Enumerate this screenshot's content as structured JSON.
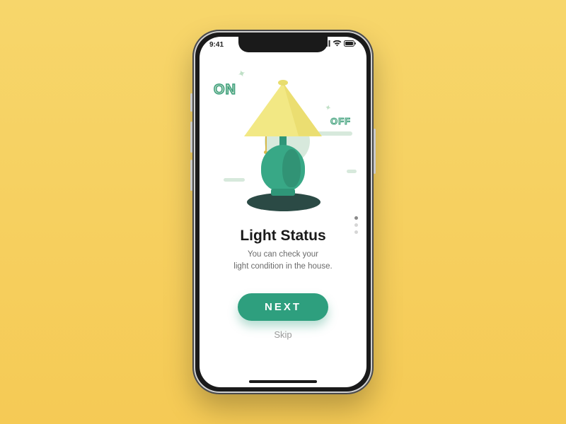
{
  "status": {
    "time": "9:41"
  },
  "illustration": {
    "on_label": "ON",
    "off_label": "OFF"
  },
  "pager": {
    "count": 3,
    "active_index": 0
  },
  "content": {
    "title": "Light Status",
    "subtitle": "You can check your\nlight condition in the house."
  },
  "actions": {
    "next_label": "NEXT",
    "skip_label": "Skip"
  },
  "colors": {
    "accent": "#2e9f7e",
    "shade": "#f2e884",
    "background": "#f6cf5c"
  }
}
